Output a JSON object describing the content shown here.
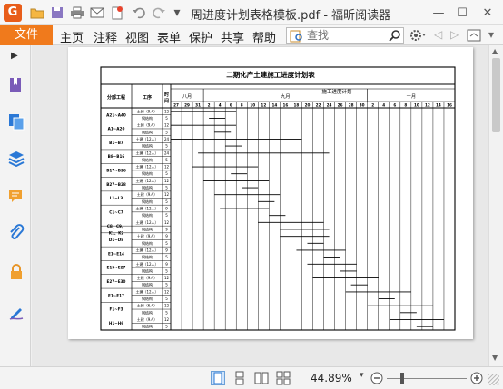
{
  "window": {
    "title": "周进度计划表格模板.pdf - 福昕阅读器",
    "minimize_glyph": "—",
    "maximize_glyph": "☐",
    "close_glyph": "✕"
  },
  "menu": {
    "file": "文件",
    "items": [
      "主页",
      "注释",
      "视图",
      "表单",
      "保护",
      "共享",
      "帮助"
    ]
  },
  "search": {
    "placeholder": "查找"
  },
  "document": {
    "title": "二期化产土建施工进度计划表",
    "header_row": [
      "分部工程",
      "工序",
      "时间"
    ],
    "plan_label": "施工进度计划",
    "months": [
      "八月",
      "九月",
      "十月"
    ],
    "days": [
      "27",
      "29",
      "31",
      "2",
      "4",
      "6",
      "8",
      "10",
      "12",
      "14",
      "16",
      "18",
      "20",
      "22",
      "24",
      "26",
      "28",
      "30",
      "2",
      "4",
      "6",
      "8",
      "10",
      "12",
      "14",
      "16"
    ],
    "rows": [
      {
        "part": "A21~A40",
        "task": "土建（9人）",
        "days": "12"
      },
      {
        "part": "",
        "task": "钢结构",
        "days": "5"
      },
      {
        "part": "A1~A20",
        "task": "土建（9人）",
        "days": "12"
      },
      {
        "part": "",
        "task": "钢结构",
        "days": "5"
      },
      {
        "part": "B1~B7",
        "task": "土建（12人）",
        "days": "24"
      },
      {
        "part": "",
        "task": "钢结构",
        "days": "5"
      },
      {
        "part": "B8~B16",
        "task": "土建（12人）",
        "days": "24"
      },
      {
        "part": "",
        "task": "钢结构",
        "days": "5"
      },
      {
        "part": "B17~B26",
        "task": "土建（12人）",
        "days": "12"
      },
      {
        "part": "",
        "task": "钢结构",
        "days": "5"
      },
      {
        "part": "B27~B28",
        "task": "土建（12人）",
        "days": "12"
      },
      {
        "part": "",
        "task": "钢结构",
        "days": "5"
      },
      {
        "part": "L1~L3",
        "task": "土建（9人）",
        "days": "12"
      },
      {
        "part": "",
        "task": "钢结构",
        "days": "5"
      },
      {
        "part": "C1~C7",
        "task": "土建（12人）",
        "days": "9"
      },
      {
        "part": "",
        "task": "钢结构",
        "days": "5"
      },
      {
        "part": "C8、C9、",
        "task": "土建（12人）",
        "days": "12"
      },
      {
        "part": "K1、K2",
        "task": "钢结构",
        "days": "9"
      },
      {
        "part": "D1~D8",
        "task": "土建（9人）",
        "days": "9"
      },
      {
        "part": "",
        "task": "钢结构",
        "days": "5"
      },
      {
        "part": "E1~E14",
        "task": "土建（12人）",
        "days": "9"
      },
      {
        "part": "",
        "task": "钢结构",
        "days": "5"
      },
      {
        "part": "E15~E27",
        "task": "土建（12人）",
        "days": "9"
      },
      {
        "part": "",
        "task": "钢结构",
        "days": "5"
      },
      {
        "part": "E27~E30",
        "task": "土建（9人）",
        "days": "12"
      },
      {
        "part": "",
        "task": "钢结构",
        "days": "5"
      },
      {
        "part": "E1~E17",
        "task": "土建（12人）",
        "days": "12"
      },
      {
        "part": "",
        "task": "钢结构",
        "days": "5"
      },
      {
        "part": "F1~F3",
        "task": "土建（6人）",
        "days": "12"
      },
      {
        "part": "",
        "task": "钢结构",
        "days": "5"
      },
      {
        "part": "H1~H6",
        "task": "土建（9人）",
        "days": "12"
      },
      {
        "part": "",
        "task": "钢结构",
        "days": "5"
      }
    ],
    "gantt": [
      [
        0,
        12
      ],
      [
        7,
        10
      ],
      [
        0,
        12
      ],
      [
        8,
        11
      ],
      [
        0,
        24
      ],
      [
        10,
        13
      ],
      [
        5,
        29
      ],
      [
        14,
        17
      ],
      [
        4,
        16
      ],
      [
        11,
        14
      ],
      [
        6,
        18
      ],
      [
        13,
        16
      ],
      [
        8,
        20
      ],
      [
        16,
        19
      ],
      [
        9,
        18
      ],
      [
        18,
        21
      ],
      [
        16,
        28
      ],
      [
        20,
        29
      ],
      [
        20,
        29
      ],
      [
        25,
        28
      ],
      [
        23,
        32
      ],
      [
        28,
        31
      ],
      [
        25,
        34
      ],
      [
        31,
        34
      ],
      [
        26,
        38
      ],
      [
        33,
        36
      ],
      [
        32,
        44
      ],
      [
        38,
        41
      ],
      [
        36,
        48
      ],
      [
        42,
        45
      ],
      [
        40,
        50
      ],
      [
        45,
        48
      ]
    ]
  },
  "status": {
    "zoom": "44.89%"
  }
}
